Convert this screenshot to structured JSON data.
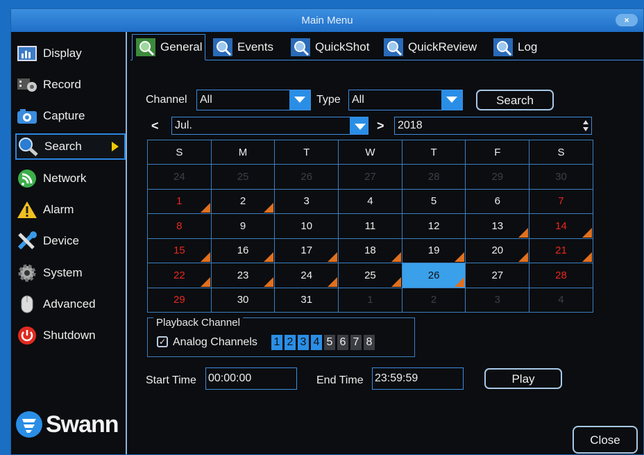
{
  "window": {
    "title": "Main Menu",
    "close_label": "×"
  },
  "sidebar": {
    "items": [
      {
        "label": "Display",
        "icon": "display-icon"
      },
      {
        "label": "Record",
        "icon": "record-icon"
      },
      {
        "label": "Capture",
        "icon": "camera-icon"
      },
      {
        "label": "Search",
        "icon": "search-icon",
        "active": true
      },
      {
        "label": "Network",
        "icon": "network-icon"
      },
      {
        "label": "Alarm",
        "icon": "alarm-icon"
      },
      {
        "label": "Device",
        "icon": "device-icon"
      },
      {
        "label": "System",
        "icon": "gear-icon"
      },
      {
        "label": "Advanced",
        "icon": "mouse-icon"
      },
      {
        "label": "Shutdown",
        "icon": "power-icon"
      }
    ],
    "logo": "Swann"
  },
  "tabs": [
    {
      "label": "General",
      "active": true
    },
    {
      "label": "Events"
    },
    {
      "label": "QuickShot"
    },
    {
      "label": "QuickReview"
    },
    {
      "label": "Log"
    }
  ],
  "filters": {
    "channel_label": "Channel",
    "channel_value": "All",
    "type_label": "Type",
    "type_value": "All",
    "search_button": "Search",
    "month_value": "Jul.",
    "year_value": "2018",
    "prev_arrow": "<",
    "next_arrow": ">"
  },
  "calendar": {
    "weekdays": [
      "S",
      "M",
      "T",
      "W",
      "T",
      "F",
      "S"
    ],
    "weeks": [
      [
        "24",
        "25",
        "26",
        "27",
        "28",
        "29",
        "30"
      ],
      [
        "1",
        "2",
        "3",
        "4",
        "5",
        "6",
        "7"
      ],
      [
        "8",
        "9",
        "10",
        "11",
        "12",
        "13",
        "14"
      ],
      [
        "15",
        "16",
        "17",
        "18",
        "19",
        "20",
        "21"
      ],
      [
        "22",
        "23",
        "24",
        "25",
        "26",
        "27",
        "28"
      ],
      [
        "29",
        "30",
        "31",
        "1",
        "2",
        "3",
        "4"
      ]
    ],
    "selected_day": "26",
    "recording_days": [
      "1",
      "2",
      "13",
      "14",
      "15",
      "16",
      "17",
      "18",
      "19",
      "20",
      "21",
      "22",
      "23",
      "24",
      "25",
      "26"
    ]
  },
  "playback": {
    "title": "Playback Channel",
    "analog_label": "Analog Channels",
    "channels": [
      "1",
      "2",
      "3",
      "4",
      "5",
      "6",
      "7",
      "8"
    ],
    "enabled_count": 4
  },
  "time": {
    "start_label": "Start Time",
    "start_value": "00:00:00",
    "end_label": "End Time",
    "end_value": "23:59:59",
    "play_button": "Play"
  },
  "close_button": "Close",
  "colors": {
    "accent": "#2a8ee6",
    "weekend": "#e8281e",
    "recording_marker": "#e0701e",
    "background": "#0b0d10"
  }
}
